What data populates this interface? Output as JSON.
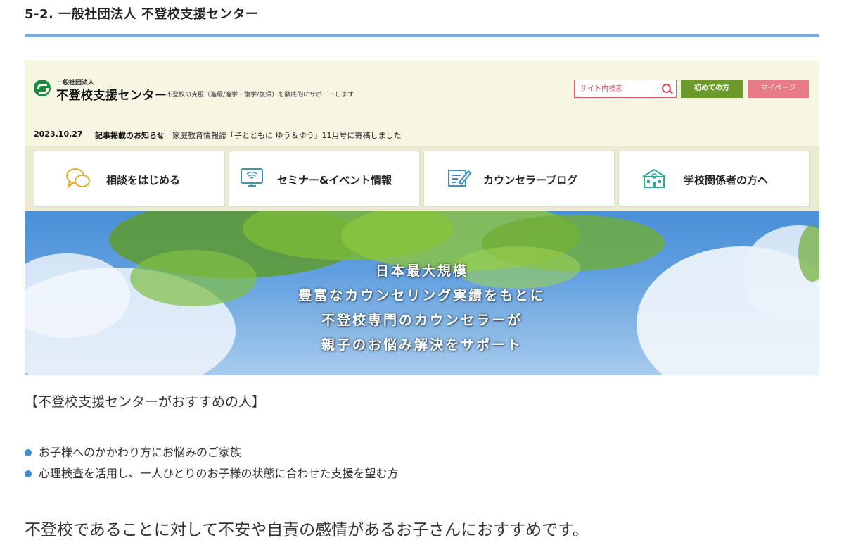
{
  "section_heading": "5-2. 一般社団法人 不登校支援センター",
  "site": {
    "logo_small": "一般社団法人",
    "logo_main": "不登校支援センター",
    "tagline": "不登校の克服（進級/進学・復学/復帰）を徹底的にサポートします",
    "search_placeholder": "サイト内検索",
    "first_visit_button": "初めての方",
    "mypage_button": "マイページ",
    "news": {
      "date": "2023.10.27",
      "category": "記事掲載のお知らせ",
      "text": "家庭教育情報誌「子とともに ゆう＆ゆう」11月号に寄稿しました"
    },
    "nav": [
      {
        "label": "相談をはじめる",
        "icon": "chat-bubbles-icon"
      },
      {
        "label": "セミナー&イベント情報",
        "icon": "monitor-icon"
      },
      {
        "label": "カウンセラーブログ",
        "icon": "pen-note-icon"
      },
      {
        "label": "学校関係者の方へ",
        "icon": "school-icon"
      }
    ],
    "hero_lines": [
      "日本最大規模",
      "豊富なカウンセリング実績をもとに",
      "不登校専門のカウンセラーが",
      "親子のお悩み解決をサポート"
    ]
  },
  "recommend_title": "【不登校支援センターがおすすめの人】",
  "recommend_items": [
    "お子様へのかかわり方にお悩みのご家族",
    "心理検査を活用し、一人ひとりのお子様の状態に合わせた支援を望む方"
  ],
  "closing_text": "不登校であることに対して不安や自責の感情があるお子さんにおすすめです。",
  "colors": {
    "rule": "#7ea9d8",
    "accent_green": "#6a9a2a",
    "accent_pink": "#e87c86",
    "bullet": "#3a8fd4"
  }
}
